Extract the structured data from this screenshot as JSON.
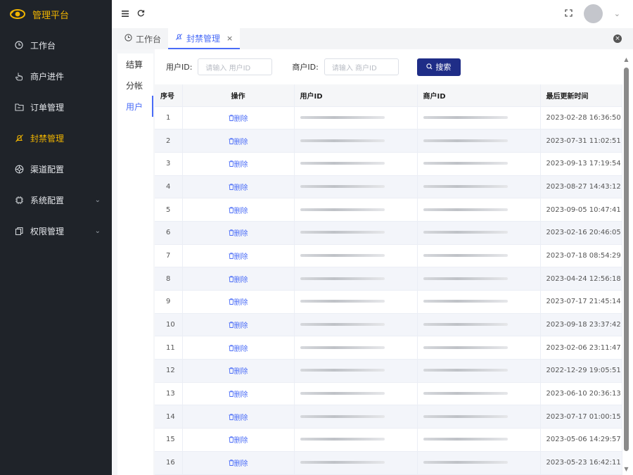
{
  "brand": {
    "title": "管理平台",
    "logo_icon": "eye-logo-icon"
  },
  "sidebar": {
    "items": [
      {
        "label": "工作台",
        "icon": "clock-icon",
        "active": false,
        "has_caret": false
      },
      {
        "label": "商户进件",
        "icon": "hand-pointer-icon",
        "active": false,
        "has_caret": false
      },
      {
        "label": "订单管理",
        "icon": "folder-icon",
        "active": false,
        "has_caret": false
      },
      {
        "label": "封禁管理",
        "icon": "bell-off-icon",
        "active": true,
        "has_caret": false
      },
      {
        "label": "渠道配置",
        "icon": "aperture-icon",
        "active": false,
        "has_caret": false
      },
      {
        "label": "系统配置",
        "icon": "cpu-icon",
        "active": false,
        "has_caret": true
      },
      {
        "label": "权限管理",
        "icon": "copy-icon",
        "active": false,
        "has_caret": true
      }
    ]
  },
  "tabs": [
    {
      "label": "工作台",
      "icon": "clock-icon",
      "active": false
    },
    {
      "label": "封禁管理",
      "icon": "bell-off-icon",
      "active": true,
      "close": "×"
    }
  ],
  "subnav": [
    "结算",
    "分帐",
    "用户"
  ],
  "filters": {
    "user_label": "用户ID:",
    "user_placeholder": "请输入 用户ID",
    "merchant_label": "商户ID:",
    "merchant_placeholder": "请输入 商户ID",
    "search_label": "搜索"
  },
  "table": {
    "headers": [
      "序号",
      "操作",
      "用户ID",
      "商户ID",
      "最后更新时间"
    ],
    "delete_label": "删除",
    "rows": [
      {
        "idx": "1",
        "time": "2023-02-28 16:36:50"
      },
      {
        "idx": "2",
        "time": "2023-07-31 11:02:51"
      },
      {
        "idx": "3",
        "time": "2023-09-13 17:19:54"
      },
      {
        "idx": "4",
        "time": "2023-08-27 14:43:12"
      },
      {
        "idx": "5",
        "time": "2023-09-05 10:47:41"
      },
      {
        "idx": "6",
        "time": "2023-02-16 20:46:05"
      },
      {
        "idx": "7",
        "time": "2023-07-18 08:54:29"
      },
      {
        "idx": "8",
        "time": "2023-04-24 12:56:18"
      },
      {
        "idx": "9",
        "time": "2023-07-17 21:45:14"
      },
      {
        "idx": "10",
        "time": "2023-09-18 23:37:42"
      },
      {
        "idx": "11",
        "time": "2023-02-06 23:11:47"
      },
      {
        "idx": "12",
        "time": "2022-12-29 19:05:51"
      },
      {
        "idx": "13",
        "time": "2023-06-10 20:36:13"
      },
      {
        "idx": "14",
        "time": "2023-07-17 01:00:15"
      },
      {
        "idx": "15",
        "time": "2023-05-06 14:29:57"
      },
      {
        "idx": "16",
        "time": "2023-05-23 16:42:11"
      }
    ]
  },
  "colors": {
    "accent": "#4a6cf7",
    "brand": "#f0b400",
    "sidebar_bg": "#1f2329",
    "search_btn": "#1f2d87"
  }
}
